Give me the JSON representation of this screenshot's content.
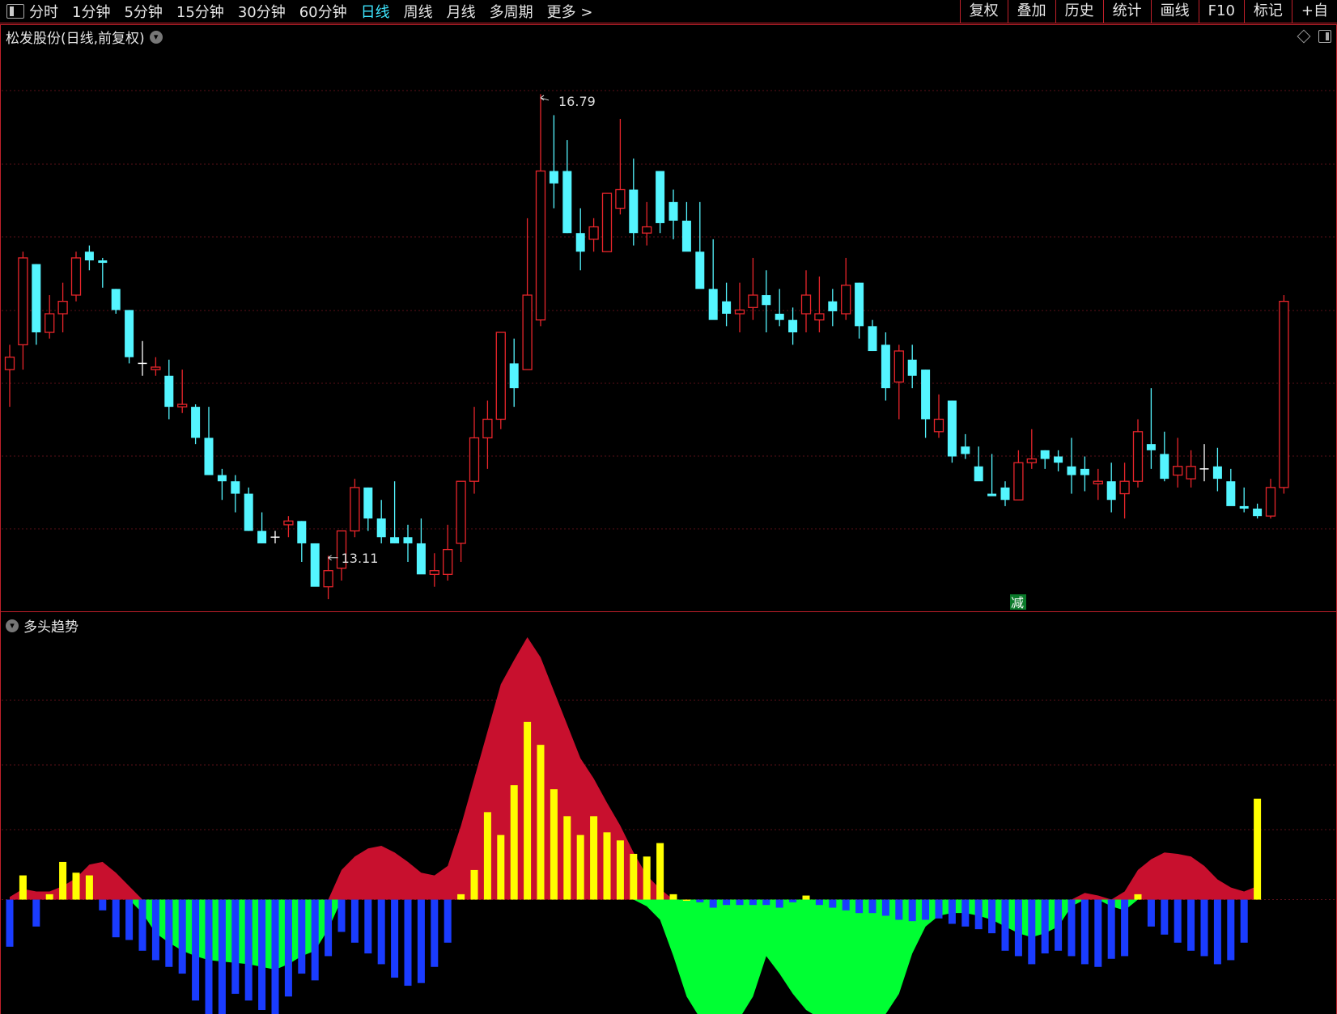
{
  "toolbar": {
    "periods": [
      "分时",
      "1分钟",
      "5分钟",
      "15分钟",
      "30分钟",
      "60分钟",
      "日线",
      "周线",
      "月线",
      "多周期",
      "更多 >"
    ],
    "active_period": "日线",
    "tools": [
      "复权",
      "叠加",
      "历史",
      "统计",
      "画线",
      "F10",
      "标记",
      "+自"
    ]
  },
  "main_chart": {
    "title": "松发股份(日线,前复权)",
    "high_label": "16.79",
    "low_label": "13.11",
    "signal_label": "减"
  },
  "indicator": {
    "title": "多头趋势"
  },
  "colors": {
    "up": "#e8252b",
    "down": "#54f5ff",
    "red_area": "#c8102e",
    "green_area": "#00ff33",
    "yellow_bar": "#ffff00",
    "blue_bar": "#1a3cff",
    "active_period": "#3ee6ff"
  },
  "chart_data": [
    {
      "type": "candlestick",
      "ylim": [
        12.9,
        17.2
      ],
      "price_high": 16.79,
      "price_low": 13.11,
      "candles": [
        [
          14.6,
          14.8,
          14.3,
          14.7
        ],
        [
          14.8,
          15.55,
          14.6,
          15.5
        ],
        [
          15.45,
          15.45,
          14.8,
          14.9
        ],
        [
          14.9,
          15.2,
          14.85,
          15.05
        ],
        [
          15.05,
          15.3,
          14.9,
          15.15
        ],
        [
          15.2,
          15.55,
          15.15,
          15.5
        ],
        [
          15.55,
          15.6,
          15.4,
          15.48
        ],
        [
          15.48,
          15.5,
          15.26,
          15.46
        ],
        [
          15.25,
          15.25,
          15.05,
          15.08
        ],
        [
          15.08,
          15.08,
          14.65,
          14.7
        ],
        [
          14.65,
          14.83,
          14.55,
          14.65
        ],
        [
          14.6,
          14.7,
          14.55,
          14.62
        ],
        [
          14.55,
          14.68,
          14.2,
          14.3
        ],
        [
          14.3,
          14.6,
          14.25,
          14.32
        ],
        [
          14.3,
          14.32,
          14.0,
          14.05
        ],
        [
          14.05,
          14.3,
          13.75,
          13.75
        ],
        [
          13.75,
          13.8,
          13.55,
          13.7
        ],
        [
          13.7,
          13.75,
          13.45,
          13.6
        ],
        [
          13.6,
          13.65,
          13.3,
          13.3
        ],
        [
          13.3,
          13.45,
          13.2,
          13.2
        ],
        [
          13.25,
          13.3,
          13.2,
          13.25
        ],
        [
          13.35,
          13.42,
          13.25,
          13.38
        ],
        [
          13.38,
          13.38,
          13.05,
          13.2
        ],
        [
          13.2,
          13.2,
          12.95,
          12.85
        ],
        [
          12.85,
          13.1,
          12.75,
          12.98
        ],
        [
          13.0,
          13.3,
          12.9,
          13.3
        ],
        [
          13.3,
          13.72,
          13.25,
          13.65
        ],
        [
          13.65,
          13.65,
          13.3,
          13.4
        ],
        [
          13.4,
          13.55,
          13.2,
          13.25
        ],
        [
          13.25,
          13.7,
          13.2,
          13.2
        ],
        [
          13.25,
          13.35,
          13.05,
          13.2
        ],
        [
          13.2,
          13.4,
          13.15,
          12.95
        ],
        [
          12.95,
          13.12,
          12.85,
          12.98
        ],
        [
          12.95,
          13.35,
          12.9,
          13.15
        ],
        [
          13.2,
          13.5,
          13.05,
          13.7
        ],
        [
          13.7,
          14.3,
          13.6,
          14.05
        ],
        [
          14.05,
          14.35,
          13.8,
          14.2
        ],
        [
          14.2,
          14.9,
          14.12,
          14.9
        ],
        [
          14.65,
          14.85,
          14.3,
          14.45
        ],
        [
          14.6,
          15.82,
          14.6,
          15.2
        ],
        [
          15.0,
          16.82,
          14.95,
          16.2
        ],
        [
          16.2,
          16.65,
          15.9,
          16.1
        ],
        [
          16.2,
          16.45,
          15.7,
          15.7
        ],
        [
          15.7,
          15.9,
          15.4,
          15.55
        ],
        [
          15.65,
          15.82,
          15.55,
          15.75
        ],
        [
          15.55,
          15.95,
          15.55,
          16.02
        ],
        [
          15.9,
          16.62,
          15.85,
          16.05
        ],
        [
          16.05,
          16.3,
          15.6,
          15.7
        ],
        [
          15.7,
          15.95,
          15.6,
          15.75
        ],
        [
          16.2,
          16.2,
          15.7,
          15.78
        ],
        [
          15.95,
          16.05,
          15.65,
          15.8
        ],
        [
          15.8,
          15.95,
          15.7,
          15.55
        ],
        [
          15.55,
          15.95,
          15.35,
          15.25
        ],
        [
          15.25,
          15.65,
          15.05,
          15.0
        ],
        [
          15.15,
          15.3,
          14.95,
          15.05
        ],
        [
          15.05,
          15.3,
          14.9,
          15.08
        ],
        [
          15.1,
          15.5,
          15.0,
          15.2
        ],
        [
          15.2,
          15.4,
          14.9,
          15.12
        ],
        [
          15.05,
          15.25,
          14.95,
          15.0
        ],
        [
          15.0,
          15.1,
          14.8,
          14.9
        ],
        [
          15.05,
          15.4,
          14.9,
          15.2
        ],
        [
          15.0,
          15.35,
          14.9,
          15.05
        ],
        [
          15.15,
          15.25,
          14.95,
          15.07
        ],
        [
          15.05,
          15.5,
          15.0,
          15.28
        ],
        [
          15.3,
          15.3,
          14.85,
          14.95
        ],
        [
          14.95,
          15.0,
          14.75,
          14.75
        ],
        [
          14.8,
          14.9,
          14.35,
          14.45
        ],
        [
          14.5,
          14.8,
          14.2,
          14.75
        ],
        [
          14.68,
          14.8,
          14.45,
          14.55
        ],
        [
          14.6,
          14.6,
          14.05,
          14.2
        ],
        [
          14.1,
          14.4,
          14.05,
          14.2
        ],
        [
          14.35,
          14.35,
          13.85,
          13.9
        ],
        [
          13.98,
          14.08,
          13.88,
          13.92
        ],
        [
          13.82,
          13.98,
          13.75,
          13.7
        ],
        [
          13.6,
          13.92,
          13.6,
          13.58
        ],
        [
          13.65,
          13.7,
          13.5,
          13.55
        ],
        [
          13.55,
          13.95,
          13.55,
          13.85
        ],
        [
          13.85,
          14.12,
          13.8,
          13.88
        ],
        [
          13.95,
          13.95,
          13.8,
          13.88
        ],
        [
          13.9,
          13.95,
          13.78,
          13.85
        ],
        [
          13.82,
          14.05,
          13.6,
          13.75
        ],
        [
          13.8,
          13.9,
          13.62,
          13.75
        ],
        [
          13.68,
          13.8,
          13.55,
          13.7
        ],
        [
          13.7,
          13.85,
          13.45,
          13.55
        ],
        [
          13.6,
          13.85,
          13.4,
          13.7
        ],
        [
          13.7,
          14.2,
          13.65,
          14.1
        ],
        [
          14.0,
          14.45,
          13.8,
          13.95
        ],
        [
          13.92,
          14.1,
          13.7,
          13.72
        ],
        [
          13.75,
          14.05,
          13.65,
          13.82
        ],
        [
          13.72,
          13.95,
          13.65,
          13.82
        ],
        [
          13.8,
          14.0,
          13.7,
          13.8
        ],
        [
          13.82,
          13.97,
          13.62,
          13.72
        ],
        [
          13.7,
          13.8,
          13.55,
          13.5
        ],
        [
          13.5,
          13.65,
          13.45,
          13.48
        ],
        [
          13.48,
          13.52,
          13.4,
          13.42
        ],
        [
          13.42,
          13.72,
          13.4,
          13.65
        ],
        [
          13.65,
          15.2,
          13.6,
          15.15
        ]
      ]
    },
    {
      "type": "area+bar",
      "ylim": [
        -0.85,
        1.95
      ],
      "red_area": [
        0.02,
        0.08,
        0.06,
        0.06,
        0.1,
        0.16,
        0.26,
        0.28,
        0.2,
        0.1,
        0,
        0,
        0,
        0,
        0,
        0,
        0,
        0,
        0,
        0,
        0,
        0,
        0,
        0,
        0,
        0.22,
        0.32,
        0.38,
        0.4,
        0.35,
        0.28,
        0.2,
        0.18,
        0.25,
        0.55,
        0.9,
        1.25,
        1.6,
        1.78,
        1.95,
        1.8,
        1.55,
        1.3,
        1.05,
        0.9,
        0.72,
        0.55,
        0.35,
        0.18,
        0.08,
        0,
        0,
        0,
        0,
        0,
        0,
        0,
        0,
        0,
        0,
        0,
        0,
        0,
        0,
        0,
        0,
        0,
        0,
        0,
        0,
        0,
        0,
        0,
        0,
        0,
        0,
        0,
        0,
        0,
        0,
        0,
        0.05,
        0.03,
        0,
        0.06,
        0.22,
        0.3,
        0.35,
        0.34,
        0.32,
        0.25,
        0.15,
        0.09,
        0.06,
        0.1
      ],
      "green_area": [
        0,
        0,
        0,
        0,
        0,
        0,
        0,
        0,
        0,
        0,
        -0.1,
        -0.25,
        -0.32,
        -0.38,
        -0.42,
        -0.45,
        -0.46,
        -0.47,
        -0.48,
        -0.5,
        -0.52,
        -0.48,
        -0.42,
        -0.38,
        -0.22,
        0,
        0,
        0,
        0,
        0,
        0,
        0,
        0,
        0,
        0,
        0,
        0,
        0,
        0,
        0,
        0,
        0,
        0,
        0,
        0,
        0,
        0,
        0,
        -0.05,
        -0.15,
        -0.42,
        -0.72,
        -0.88,
        -0.96,
        -0.92,
        -0.88,
        -0.72,
        -0.42,
        -0.55,
        -0.7,
        -0.82,
        -0.88,
        -0.92,
        -0.95,
        -0.96,
        -0.95,
        -0.85,
        -0.7,
        -0.4,
        -0.2,
        -0.12,
        -0.1,
        -0.1,
        -0.12,
        -0.15,
        -0.2,
        -0.25,
        -0.28,
        -0.25,
        -0.2,
        -0.05,
        0,
        0,
        -0.05,
        -0.08,
        0,
        0,
        0,
        0,
        0,
        0,
        0,
        0,
        0,
        0
      ],
      "bars": [
        -0.35,
        0.18,
        -0.2,
        0.04,
        0.28,
        0.2,
        0.18,
        -0.08,
        -0.28,
        -0.3,
        -0.38,
        -0.45,
        -0.5,
        -0.55,
        -0.75,
        -0.9,
        -0.85,
        -0.7,
        -0.75,
        -0.82,
        -0.85,
        -0.72,
        -0.55,
        -0.6,
        -0.42,
        -0.24,
        -0.32,
        -0.4,
        -0.48,
        -0.58,
        -0.64,
        -0.62,
        -0.5,
        -0.32,
        0.04,
        0.22,
        0.65,
        0.48,
        0.85,
        1.32,
        1.15,
        0.82,
        0.62,
        0.48,
        0.62,
        0.5,
        0.44,
        0.34,
        0.32,
        0.42,
        0.04,
        0,
        -0.02,
        -0.06,
        -0.04,
        -0.04,
        -0.04,
        -0.04,
        -0.06,
        -0.02,
        0.03,
        -0.04,
        -0.06,
        -0.08,
        -0.1,
        -0.1,
        -0.12,
        -0.15,
        -0.16,
        -0.15,
        -0.14,
        -0.18,
        -0.2,
        -0.22,
        -0.25,
        -0.38,
        -0.42,
        -0.48,
        -0.4,
        -0.38,
        -0.42,
        -0.48,
        -0.5,
        -0.44,
        -0.42,
        0.04,
        -0.2,
        -0.26,
        -0.32,
        -0.38,
        -0.42,
        -0.48,
        -0.45,
        -0.32,
        0.75
      ]
    }
  ]
}
